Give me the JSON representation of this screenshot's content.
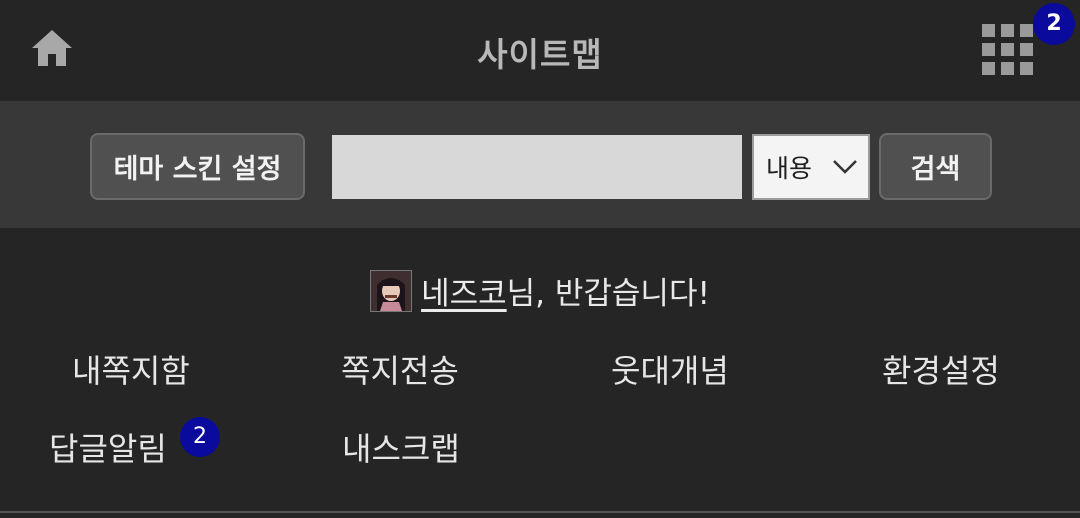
{
  "header": {
    "title": "사이트맵",
    "home_icon": "home-icon",
    "grid_icon": "grid-menu-icon",
    "notification_count": "2"
  },
  "search": {
    "theme_button": "테마 스킨 설정",
    "input_value": "",
    "input_placeholder": "",
    "select_value": "내용",
    "submit_button": "검색"
  },
  "welcome": {
    "username": "네즈코",
    "suffix": "님, 반갑습니다!"
  },
  "menu": {
    "items": [
      {
        "label": "내쪽지함"
      },
      {
        "label": "쪽지전송"
      },
      {
        "label": "웃대개념"
      },
      {
        "label": "환경설정"
      },
      {
        "label": "답글알림",
        "badge": "2"
      },
      {
        "label": "내스크랩"
      }
    ]
  },
  "colors": {
    "background": "#252525",
    "search_bar": "#383838",
    "badge": "#0a0a9c"
  }
}
